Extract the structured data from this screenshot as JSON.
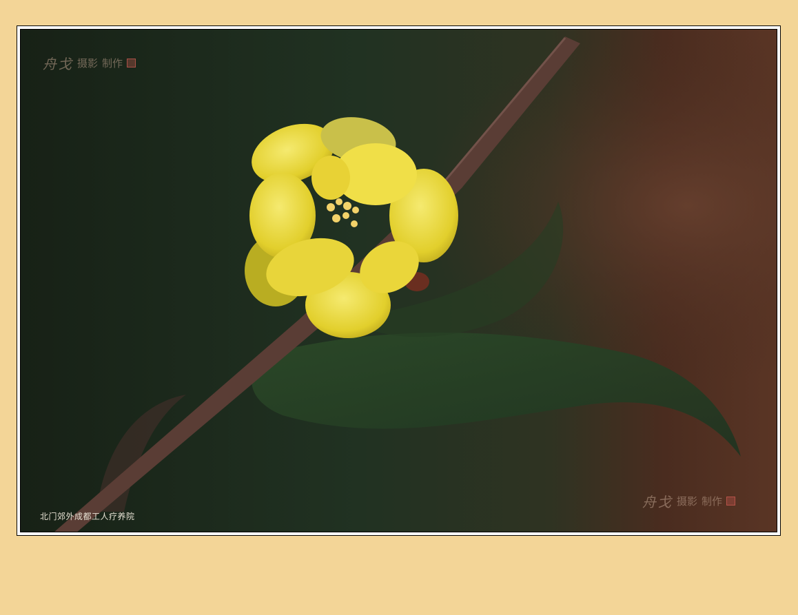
{
  "photo": {
    "subject": "yellow wintersweet blossom on branch",
    "caption": "北门郊外成都工人疗养院"
  },
  "watermark": {
    "signature": "舟戈",
    "word_photo": "摄影",
    "word_made": "制作"
  },
  "colors": {
    "mat": "#f3d597",
    "background_dark": "#1f2d1b",
    "petal": "#e6d13a",
    "branch": "#5a3d35"
  }
}
